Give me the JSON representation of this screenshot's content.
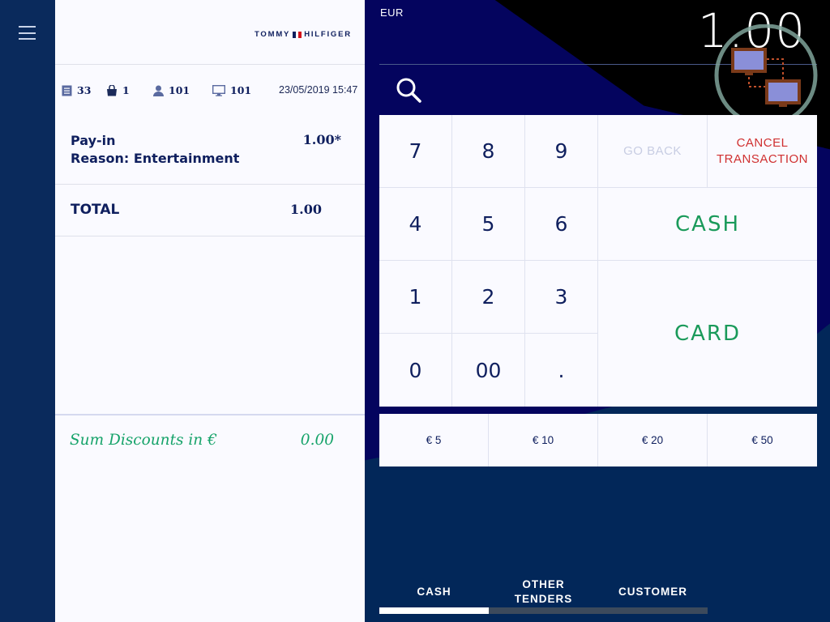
{
  "brand": {
    "left": "TOMMY",
    "right": "HILFIGER"
  },
  "stats": {
    "receipts": "33",
    "bag": "1",
    "user": "101",
    "terminal": "101",
    "datetime": "23/05/2019 15:47"
  },
  "line_item": {
    "name": "Pay-in",
    "reason": "Reason: Entertainment",
    "value": "1.00*"
  },
  "total": {
    "label": "TOTAL",
    "value": "1.00"
  },
  "discounts": {
    "label": "Sum Discounts in €",
    "value": "0.00"
  },
  "header": {
    "currency": "EUR",
    "amount": "1.00"
  },
  "keypad": {
    "digits": [
      "7",
      "8",
      "9",
      "4",
      "5",
      "6",
      "1",
      "2",
      "3",
      "0",
      "00",
      "."
    ],
    "go_back": "GO BACK",
    "cancel_line1": "CANCEL",
    "cancel_line2": "TRANSACTION",
    "cash": "CASH",
    "card": "CARD"
  },
  "quick_amounts": [
    "€ 5",
    "€ 10",
    "€ 20",
    "€ 50"
  ],
  "tabs": [
    {
      "label": "CASH",
      "active": true
    },
    {
      "label_line1": "OTHER",
      "label_line2": "TENDERS",
      "active": false
    },
    {
      "label": "CUSTOMER",
      "active": false
    }
  ],
  "colors": {
    "navy": "#0f1f5e",
    "pay_green": "#1a9a5a",
    "cancel_red": "#d03030",
    "discount_green": "#16a36a"
  },
  "icons": [
    "menu-icon",
    "receipt-icon",
    "bag-icon",
    "user-icon",
    "monitor-icon",
    "search-icon",
    "connection-status-icon"
  ]
}
